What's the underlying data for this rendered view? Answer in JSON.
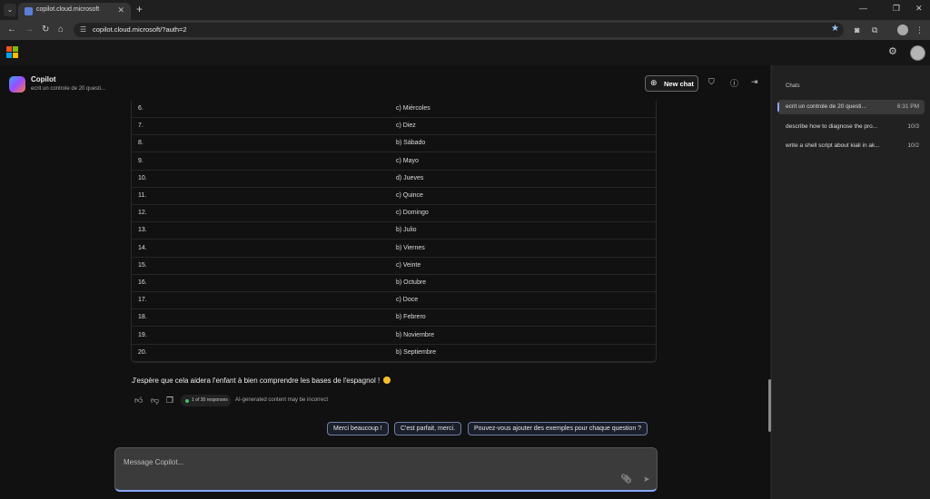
{
  "browser": {
    "tab_title": "copilot.cloud.microsoft",
    "tab_close": "✕",
    "new_tab": "+",
    "url": "copilot.cloud.microsoft/?auth=2"
  },
  "header": {
    "title": "Copilot",
    "subtitle": "ecrit un controle de 20 questi...",
    "new_chat_label": "New chat"
  },
  "answers_table": [
    {
      "num": "6.",
      "answer": "c) Miércoles"
    },
    {
      "num": "7.",
      "answer": "c) Diez"
    },
    {
      "num": "8.",
      "answer": "b) Sábado"
    },
    {
      "num": "9.",
      "answer": "c) Mayo"
    },
    {
      "num": "10.",
      "answer": "d) Jueves"
    },
    {
      "num": "11.",
      "answer": "c) Quince"
    },
    {
      "num": "12.",
      "answer": "c) Domingo"
    },
    {
      "num": "13.",
      "answer": "b) Julio"
    },
    {
      "num": "14.",
      "answer": "b) Viernes"
    },
    {
      "num": "15.",
      "answer": "c) Veinte"
    },
    {
      "num": "16.",
      "answer": "b) Octubre"
    },
    {
      "num": "17.",
      "answer": "c) Doce"
    },
    {
      "num": "18.",
      "answer": "b) Febrero"
    },
    {
      "num": "19.",
      "answer": "b) Noviembre"
    },
    {
      "num": "20.",
      "answer": "b) Septiembre"
    }
  ],
  "message": {
    "closing_text": "J'espère que cela aidera l'enfant à bien comprendre les bases de l'espagnol !",
    "responses_badge": "1 of 30 responses",
    "disclaimer": "AI-generated content may be incorrect"
  },
  "suggestions": [
    "Merci beaucoup !",
    "C'est parfait, merci.",
    "Pouvez-vous ajouter des exemples pour chaque question ?"
  ],
  "composer": {
    "placeholder": "Message Copilot..."
  },
  "sidebar": {
    "heading": "Chats",
    "chats": [
      {
        "title": "ecrit un controle de 20 questi...",
        "time": "6:31 PM"
      },
      {
        "title": "describe how to diagnose the pro...",
        "time": "10/3"
      },
      {
        "title": "write a shell script about kiali in ak...",
        "time": "10/2"
      }
    ]
  },
  "colors": {
    "accent": "#8aa6ff",
    "status_dot": "#3fc06a",
    "ms_red": "#f25022",
    "ms_green": "#7fba00",
    "ms_blue": "#00a4ef",
    "ms_yellow": "#ffb900"
  }
}
